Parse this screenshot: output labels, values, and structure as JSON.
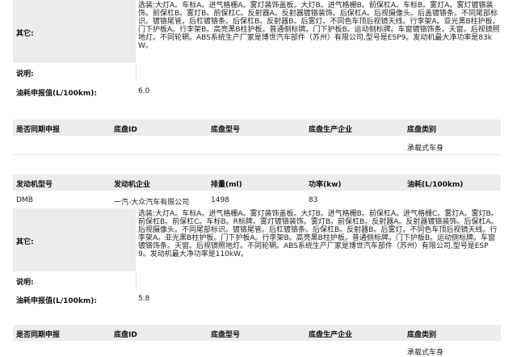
{
  "block1": {
    "other_label": "其它:",
    "other_text": "选装:大灯A。车标A。进气格栅A。雾灯装饰盖板。大灯B。进气格栅B。前保杠A。车标B。雾灯A。雾灯镀铬装饰。前保杠B。雾灯B。前保杠C。反射器A。反射器镀铬装饰。后保杠A。后视摄像头。后盖镀铬条。不同尾部标识。镀铬尾管。后杠镀铬条。后保杠B。反射器B。后雾灯。不同色车顶后视镜天线。行李架A。亚光黑B柱护板。门下护板A。行李架B。高亮黑B柱护板。普通侧标牌。门下护板B。运动侧标牌。车窗镀铬饰条。天窗。后视镜照地灯。不同轮辋。ABS系统生产厂家是博世汽车部件（苏州）有限公司,型号是ESP9。发动机最大净功率是83kW。",
    "note_label": "说明:",
    "note_value": "",
    "fuel_label": "油耗申报值(L/100km):",
    "fuel_value": "6.0"
  },
  "chassis1": {
    "headers": [
      "是否同期申报",
      "底盘ID",
      "底盘型号",
      "底盘生产企业",
      "底盘类别"
    ],
    "values": [
      "",
      "",
      "",
      "",
      "承载式车身"
    ]
  },
  "engine": {
    "headers": [
      "发动机型号",
      "发动机企业",
      "排量(ml)",
      "功率(kw)",
      "油耗(L/100km)"
    ],
    "values": [
      "DMB",
      "一汽-大众汽车有限公司",
      "1498",
      "83",
      ""
    ]
  },
  "block2": {
    "other_label": "其它:",
    "other_text": "选装:大灯A。车标A。进气格栅A。雾灯装饰盖板。大灯B。进气格栅B。前保杠A。进气格栅C。雾灯A。雾灯B。前保杠B。前保杠C。车标B。R标牌。雾灯镀铬装饰。雾灯B。前保杠B。反射器A。反射器镀铬装饰。后保杠A。后视摄像头。不同尾部标识。镀铬尾管。后杠镀铬条。后保杠B。反射器B。后雾灯。不同色车顶后视镜天线。行李架A。亚光黑B柱护板。门下护板A。行李架B。高亮黑B柱护板。普通侧标牌。门下护板B。运动侧标牌。车窗镀铬饰条。天窗。后视镜照地灯。不同轮辋。ABS系统生产厂家是博世汽车部件（苏州）有限公司,型号是ESP9。发动机最大净功率是110kW。",
    "note_label": "说明:",
    "note_value": "",
    "fuel_label": "油耗申报值(L/100km):",
    "fuel_value": "5.8"
  },
  "chassis2": {
    "headers": [
      "是否同期申报",
      "底盘ID",
      "底盘型号",
      "底盘生产企业",
      "底盘类别"
    ],
    "values": [
      "",
      "",
      "",
      "",
      "承载式车身"
    ]
  }
}
